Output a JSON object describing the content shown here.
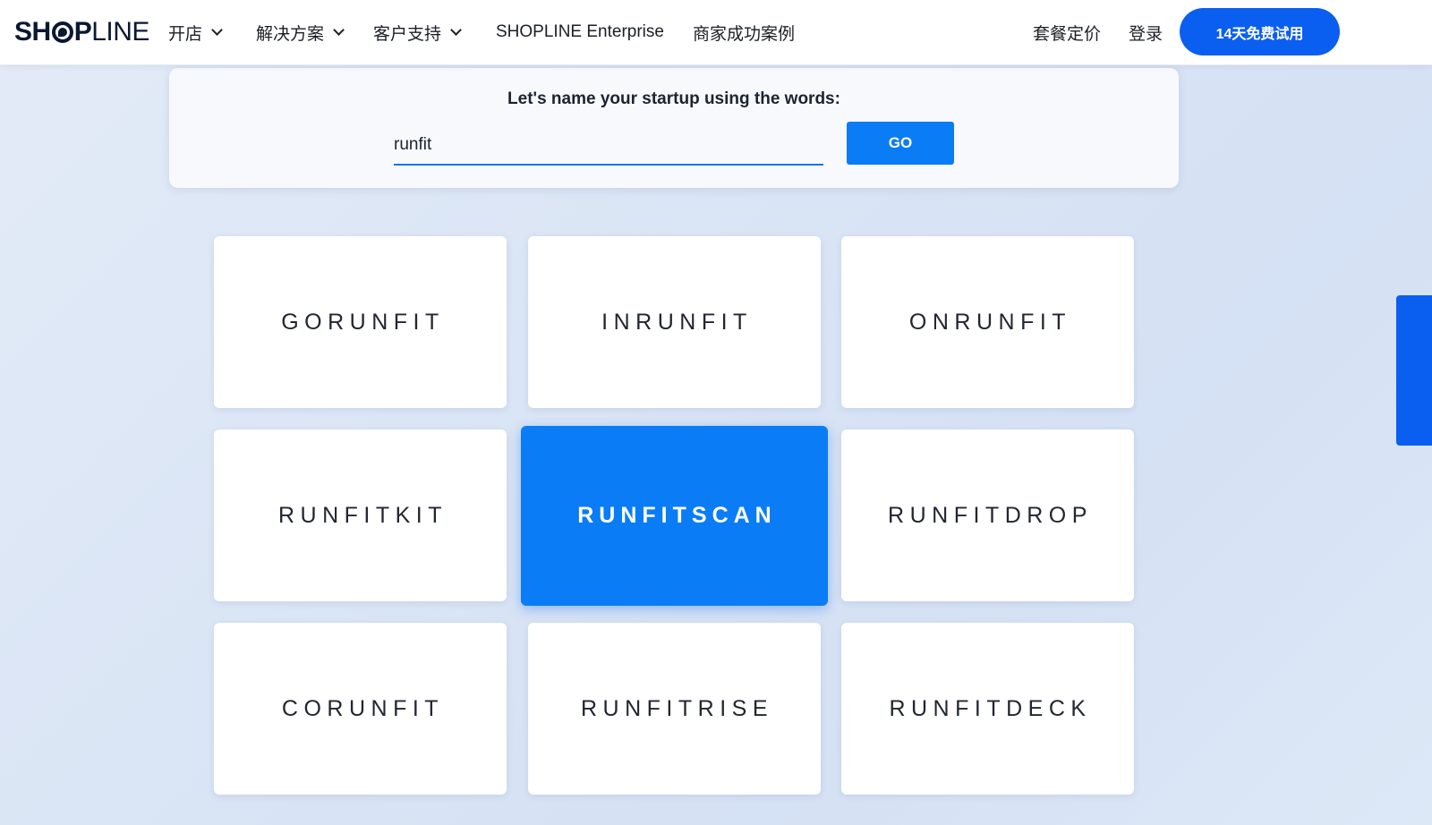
{
  "header": {
    "logo": {
      "part1": "SH",
      "part2": "P",
      "part3": "LINE",
      "icon": "shopline-o-mark"
    },
    "nav": [
      {
        "label": "开店",
        "has_dropdown": true
      },
      {
        "label": "解决方案",
        "has_dropdown": true
      },
      {
        "label": "客户支持",
        "has_dropdown": true
      },
      {
        "label": "SHOPLINE Enterprise",
        "has_dropdown": false
      },
      {
        "label": "商家成功案例",
        "has_dropdown": false
      }
    ],
    "pricing_label": "套餐定价",
    "login_label": "登录",
    "trial_label": "14天免费试用"
  },
  "search": {
    "title": "Let's name your startup using the words:",
    "value": "runfit",
    "go_label": "GO"
  },
  "names": [
    {
      "label": "GORUNFIT",
      "selected": false
    },
    {
      "label": "INRUNFIT",
      "selected": false
    },
    {
      "label": "ONRUNFIT",
      "selected": false
    },
    {
      "label": "RUNFITKIT",
      "selected": false
    },
    {
      "label": "RUNFITSCAN",
      "selected": true
    },
    {
      "label": "RUNFITDROP",
      "selected": false
    },
    {
      "label": "CORUNFIT",
      "selected": false
    },
    {
      "label": "RUNFITRISE",
      "selected": false
    },
    {
      "label": "RUNFITDECK",
      "selected": false
    }
  ],
  "colors": {
    "brand_blue": "#0a5ff0",
    "accent_blue": "#0a7cf5",
    "card_bg": "#ffffff",
    "page_bg": "#dae5f5"
  }
}
